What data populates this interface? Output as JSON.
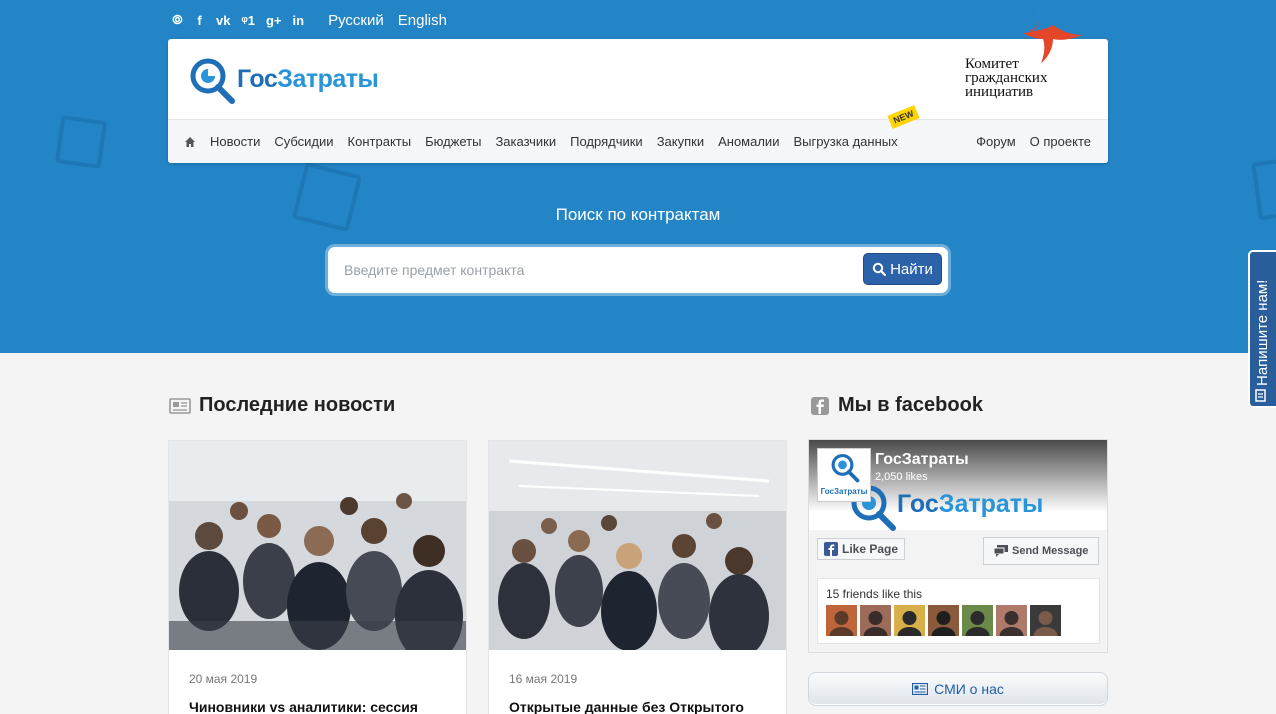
{
  "topbar": {
    "social": [
      {
        "icon": "rss-icon",
        "glyph": "⦾"
      },
      {
        "icon": "facebook-icon",
        "glyph": "f"
      },
      {
        "icon": "vk-icon",
        "glyph": "vk"
      },
      {
        "icon": "twitter-icon",
        "glyph": "ᵠ1"
      },
      {
        "icon": "google-plus-icon",
        "glyph": "g+"
      },
      {
        "icon": "linkedin-icon",
        "glyph": "in"
      }
    ],
    "lang_ru": "Русский",
    "lang_en": "English"
  },
  "header": {
    "logo_part1": "Гос",
    "logo_part2": "Затраты",
    "partner_line1": "Комитет",
    "partner_line2": "гражданских",
    "partner_line3": "инициатив"
  },
  "nav": {
    "items": [
      "Новости",
      "Субсидии",
      "Контракты",
      "Бюджеты",
      "Заказчики",
      "Подрядчики",
      "Закупки",
      "Аномалии",
      "Выгрузка данных"
    ],
    "badge_new": "NEW",
    "right_items": [
      "Форум",
      "О проекте"
    ]
  },
  "search": {
    "title": "Поиск по контрактам",
    "placeholder": "Введите предмет контракта",
    "button_label": "Найти"
  },
  "feedback_tab": "Напишите нам!",
  "news": {
    "title": "Последние новости",
    "items": [
      {
        "date": "20 мая 2019",
        "title": "Чиновники vs аналитики: сессия"
      },
      {
        "date": "16 мая 2019",
        "title": "Открытые данные без Открытого"
      }
    ]
  },
  "facebook": {
    "title": "Мы в facebook",
    "page_name": "ГосЗатраты",
    "likes": "2,050 likes",
    "like_button": "Like Page",
    "message_button": "Send Message",
    "friends_label": "15 friends like this",
    "small_logo_text": "ГосЗатраты",
    "cover_logo_part1": "Гос",
    "cover_logo_part2": "Затраты"
  },
  "smi_button": "СМИ о нас",
  "colors": {
    "hero_bg": "#2385c6",
    "brand_blue": "#1e6eb8",
    "button_blue": "#2b62a8",
    "badge_yellow": "#ffd400",
    "partner_red": "#e4462a"
  }
}
